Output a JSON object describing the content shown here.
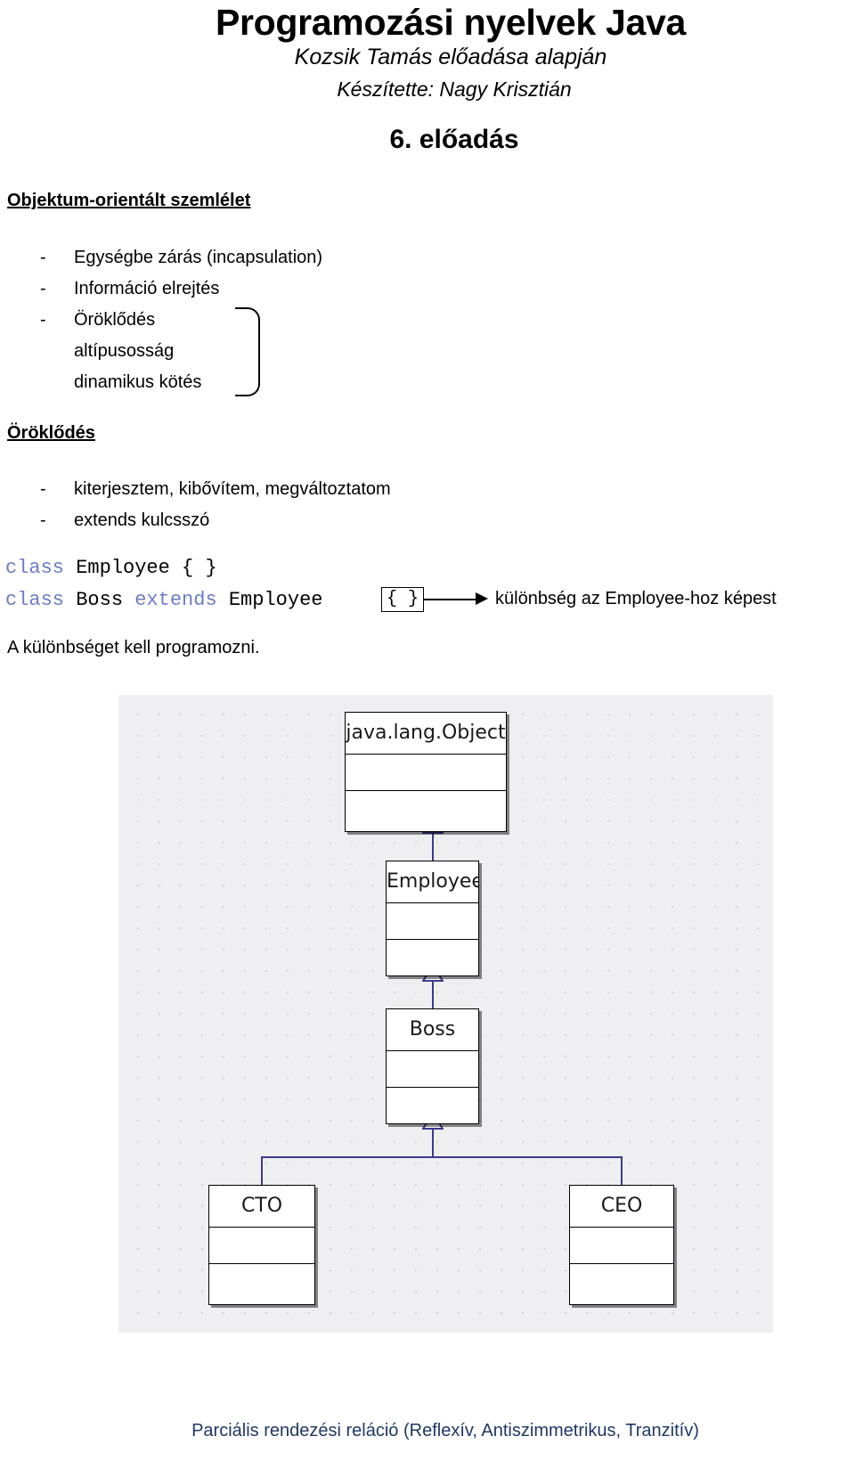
{
  "header": {
    "title": "Programozási nyelvek Java",
    "subtitle1": "Kozsik Tamás előadása alapján",
    "subtitle2": "Készítette: Nagy Krisztián",
    "lecture": "6. előadás"
  },
  "sections": {
    "oo_heading": "Objektum-orientált szemlélet",
    "inherit_heading": "Öröklődés"
  },
  "oo_list": [
    {
      "dash": "-",
      "text": "Egységbe zárás (incapsulation)"
    },
    {
      "dash": "-",
      "text": "Információ elrejtés"
    },
    {
      "dash": "-",
      "text": "Öröklődés"
    },
    {
      "dash": "",
      "text": "altípusosság"
    },
    {
      "dash": "",
      "text": "dinamikus kötés"
    }
  ],
  "inherit_list": [
    {
      "dash": "-",
      "text": "kiterjesztem, kibővítem, megváltoztatom"
    },
    {
      "dash": "-",
      "text": "extends kulcsszó"
    }
  ],
  "code": {
    "line1_kw": "class",
    "line1_name": " Employee ",
    "line1_body": "{ }",
    "line2_kw1": "class",
    "line2_name1": " Boss ",
    "line2_kw2": "extends",
    "line2_name2": " Employee ",
    "box_text": "{ }",
    "annotation": "különbség az Employee-hoz képest",
    "trailing_note": "A különbséget kell programozni."
  },
  "uml": {
    "classes": [
      {
        "id": "object",
        "name": "java.lang.Object"
      },
      {
        "id": "employee",
        "name": "Employee"
      },
      {
        "id": "boss",
        "name": "Boss"
      },
      {
        "id": "cto",
        "name": "CTO"
      },
      {
        "id": "ceo",
        "name": "CEO"
      }
    ]
  },
  "footer": {
    "text": "Parciális rendezési reláció (Reflexív, Antiszimmetrikus, Tranzitív)"
  },
  "colors": {
    "code_keyword": "#6b7dc4",
    "uml_connector": "#3b3b8f",
    "uml_background": "#efeff1",
    "footer_text": "#1f3864"
  }
}
